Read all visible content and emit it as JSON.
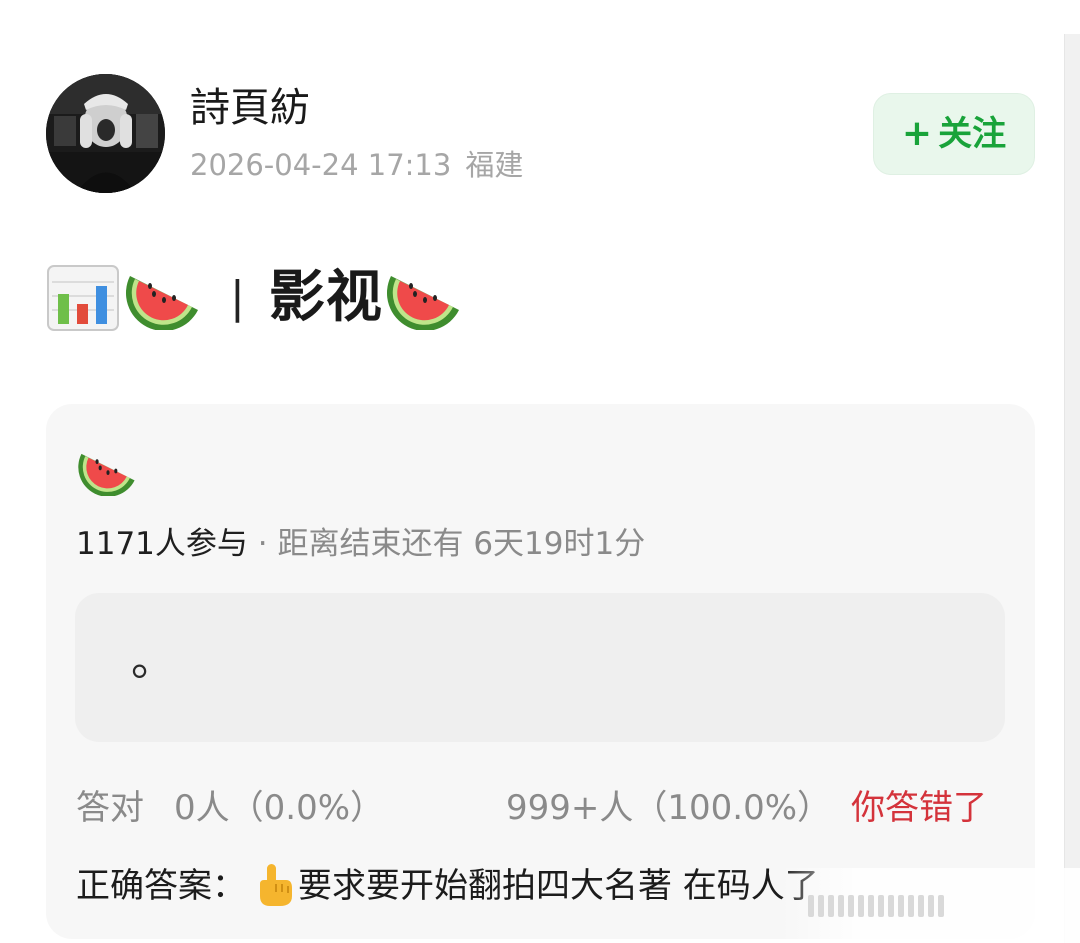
{
  "header": {
    "username": "詩頁紡",
    "timestamp": "2026-04-24 17:13",
    "location": "福建",
    "follow_plus": "+",
    "follow_label": "关注"
  },
  "post": {
    "title_separator": "|",
    "title_text": "影视",
    "title_icons": [
      "bar-chart-emoji",
      "watermelon-emoji",
      "watermelon-emoji"
    ]
  },
  "poll": {
    "participants": "1171人参与",
    "separator": " · ",
    "remaining": "距离结束还有 6天19时1分",
    "option_text": "。",
    "correct_label": "答对",
    "correct_value": "0人（0.0%）",
    "wrong_value": "999+人（100.0%）",
    "wrong_tag": "你答错了",
    "answer_label": "正确答案：",
    "answer_text": "要求要开始翻拍四大名著 在码人了"
  },
  "colors": {
    "accent_green": "#19a33a",
    "follow_bg": "#e9f7ec",
    "error_red": "#d4333b",
    "card_bg": "#f7f7f7",
    "option_bg": "#efefef"
  }
}
